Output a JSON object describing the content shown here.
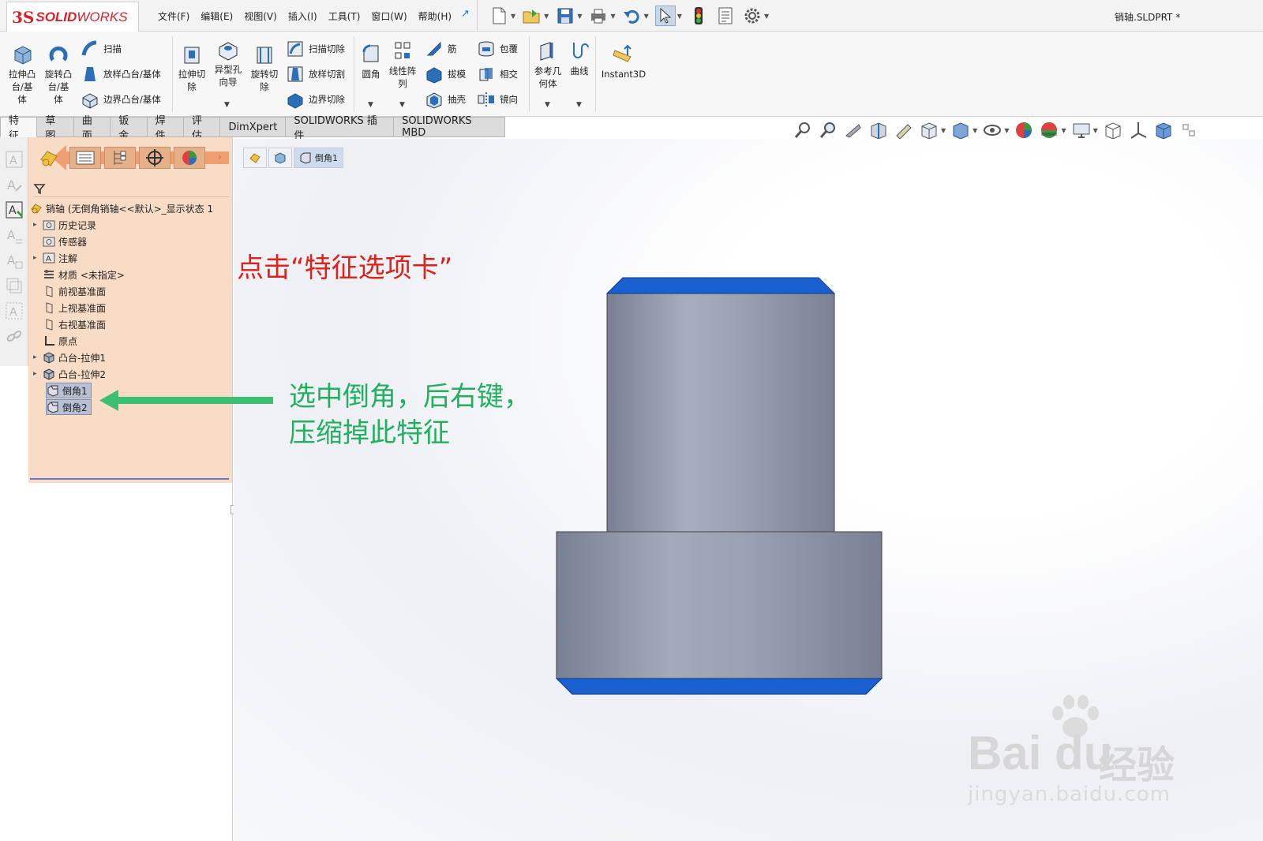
{
  "app": {
    "logo_ds": "3S",
    "logo_solid": "SOLID",
    "logo_works": "WORKS",
    "file_title": "销轴.SLDPRT *"
  },
  "menus": [
    "文件(F)",
    "编辑(E)",
    "视图(V)",
    "插入(I)",
    "工具(T)",
    "窗口(W)",
    "帮助(H)"
  ],
  "ribbon": {
    "extrude_boss": [
      "拉伸凸",
      "台/基",
      "体"
    ],
    "revolve_boss": [
      "旋转凸",
      "台/基",
      "体"
    ],
    "sweep": "扫描",
    "loft": "放样凸台/基体",
    "boundary": "边界凸台/基体",
    "extrude_cut": [
      "拉伸切",
      "除"
    ],
    "hole_wizard": [
      "异型孔",
      "向导"
    ],
    "revolve_cut": [
      "旋转切",
      "除"
    ],
    "sweep_cut": "扫描切除",
    "loft_cut": "放样切割",
    "boundary_cut": "边界切除",
    "fillet": "圆角",
    "linear_pattern": [
      "线性阵",
      "列"
    ],
    "rib": "筋",
    "draft": "拔模",
    "shell": "抽壳",
    "wrap": "包覆",
    "intersect": "相交",
    "mirror": "镜向",
    "ref_geometry": [
      "参考几",
      "何体"
    ],
    "curves": "曲线",
    "instant3d": "Instant3D"
  },
  "tabs": [
    "特征",
    "草图",
    "曲面",
    "钣金",
    "焊件",
    "评估",
    "DimXpert",
    "SOLIDWORKS 插件",
    "SOLIDWORKS MBD"
  ],
  "tree": {
    "root": "销轴  (无倒角销轴<<默认>_显示状态 1",
    "items": [
      "历史记录",
      "传感器",
      "注解",
      "材质 <未指定>",
      "前视基准面",
      "上视基准面",
      "右视基准面",
      "原点",
      "凸台-拉伸1",
      "凸台-拉伸2",
      "倒角1",
      "倒角2"
    ]
  },
  "breadcrumb": {
    "current": "倒角1"
  },
  "annotations": {
    "red": "点击“特征选项卡”",
    "green_line1": "选中倒角，后右键，",
    "green_line2": "压缩掉此特征"
  },
  "watermark": {
    "brand": "Bai du",
    "brand_cn": "经验",
    "url": "jingyan.baidu.com"
  },
  "colors": {
    "accent_red": "#e0201b",
    "accent_green": "#22b060",
    "feature_manager_bg": "#f8dcc6",
    "chamfer_blue": "#1a5fd0",
    "body_gray": "#8e94a8"
  }
}
